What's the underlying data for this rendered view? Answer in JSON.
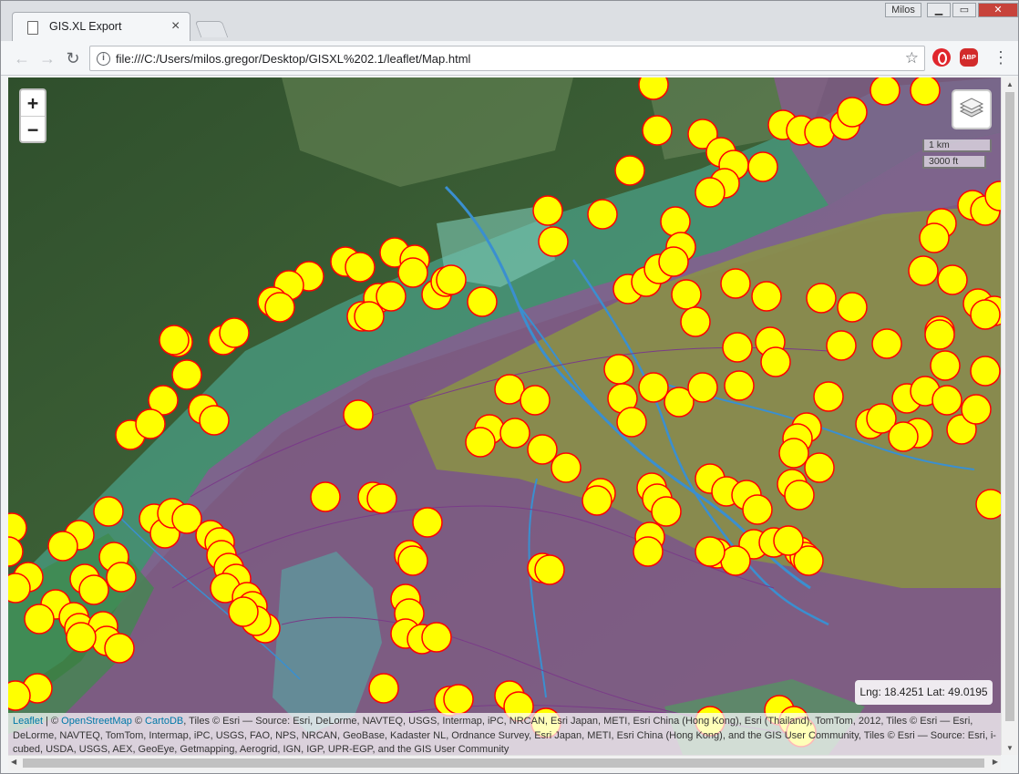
{
  "browser": {
    "tab_title": "GIS.XL Export",
    "tab_close": "×",
    "profile_name": "Milos",
    "url": "file:///C:/Users/milos.gregor/Desktop/GISXL%202.1/leaflet/Map.html",
    "extensions": {
      "abp_label": "ABP"
    },
    "icons": [
      "back-icon",
      "forward-icon",
      "reload-icon",
      "info-icon",
      "star-icon",
      "opera-icon",
      "abp-icon",
      "menu-icon",
      "document-icon"
    ]
  },
  "map": {
    "zoom_in": "+",
    "zoom_out": "−",
    "scale_metric": "1 km",
    "scale_imperial": "3000 ft",
    "coords": "Lng: 18.4251 Lat: 49.0195",
    "marker_fill": "#ffff00",
    "marker_stroke": "#ff0000",
    "attribution": {
      "leaflet": "Leaflet",
      "sep1": " | © ",
      "osm": "OpenStreetMap",
      "sep2": " © ",
      "cartodb": "CartoDB",
      "rest": ", Tiles © Esri — Source: Esri, DeLorme, NAVTEQ, USGS, Intermap, iPC, NRCAN, Esri Japan, METI, Esri China (Hong Kong), Esri (Thailand), TomTom, 2012, Tiles © Esri — Esri, DeLorme, NAVTEQ, TomTom, Intermap, iPC, USGS, FAO, NPS, NRCAN, GeoBase, Kadaster NL, Ordnance Survey, Esri Japan, METI, Esri China (Hong Kong), and the GIS User Community, Tiles © Esri — Source: Esri, i-cubed, USDA, USGS, AEX, GeoEye, Getmapping, Aerogrid, IGN, IGP, UPR-EGP, and the GIS User Community"
    }
  }
}
